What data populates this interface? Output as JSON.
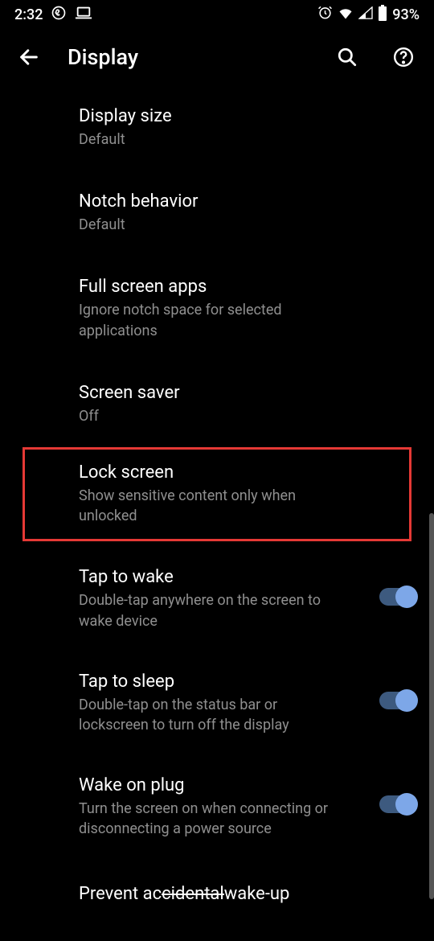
{
  "status": {
    "time": "2:32",
    "battery": "93%"
  },
  "header": {
    "title": "Display"
  },
  "items": [
    {
      "title": "Display size",
      "subtitle": "Default",
      "toggle": false,
      "highlighted": false
    },
    {
      "title": "Notch behavior",
      "subtitle": "Default",
      "toggle": false,
      "highlighted": false
    },
    {
      "title": "Full screen apps",
      "subtitle": "Ignore notch space for selected applications",
      "toggle": false,
      "highlighted": false
    },
    {
      "title": "Screen saver",
      "subtitle": "Off",
      "toggle": false,
      "highlighted": false
    },
    {
      "title": "Lock screen",
      "subtitle": "Show sensitive content only when unlocked",
      "toggle": false,
      "highlighted": true
    },
    {
      "title": "Tap to wake",
      "subtitle": "Double-tap anywhere on the screen to wake device",
      "toggle": true,
      "highlighted": false
    },
    {
      "title": "Tap to sleep",
      "subtitle": "Double-tap on the status bar or lockscreen to turn off the display",
      "toggle": true,
      "highlighted": false
    },
    {
      "title": "Wake on plug",
      "subtitle": "Turn the screen on when connecting or disconnecting a power source",
      "toggle": true,
      "highlighted": false
    }
  ],
  "lastItem": {
    "prefix": "Prevent ac",
    "strike": "cidental ",
    "suffix": "wake-up"
  }
}
